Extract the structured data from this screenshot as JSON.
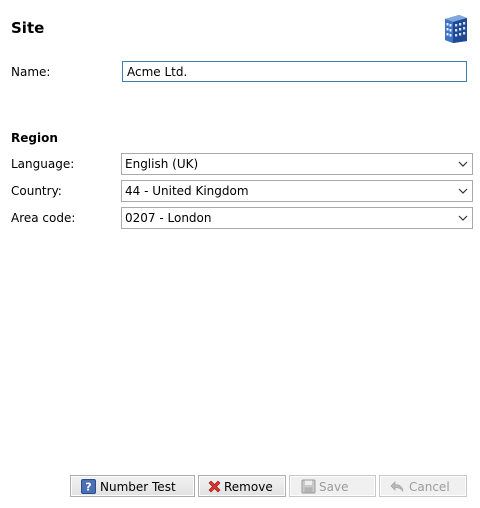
{
  "header": {
    "title": "Site",
    "icon": "building-icon"
  },
  "form": {
    "name_label": "Name:",
    "name_value": "Acme Ltd."
  },
  "region": {
    "title": "Region",
    "language_label": "Language:",
    "language_value": "English (UK)",
    "country_label": "Country:",
    "country_value": "44 - United Kingdom",
    "area_code_label": "Area code:",
    "area_code_value": "0207 - London"
  },
  "buttons": {
    "number_test": "Number Test",
    "remove": "Remove",
    "save": "Save",
    "cancel": "Cancel"
  },
  "colors": {
    "focus_border": "#3c7fb1",
    "disabled_text": "#9b9b9b"
  }
}
